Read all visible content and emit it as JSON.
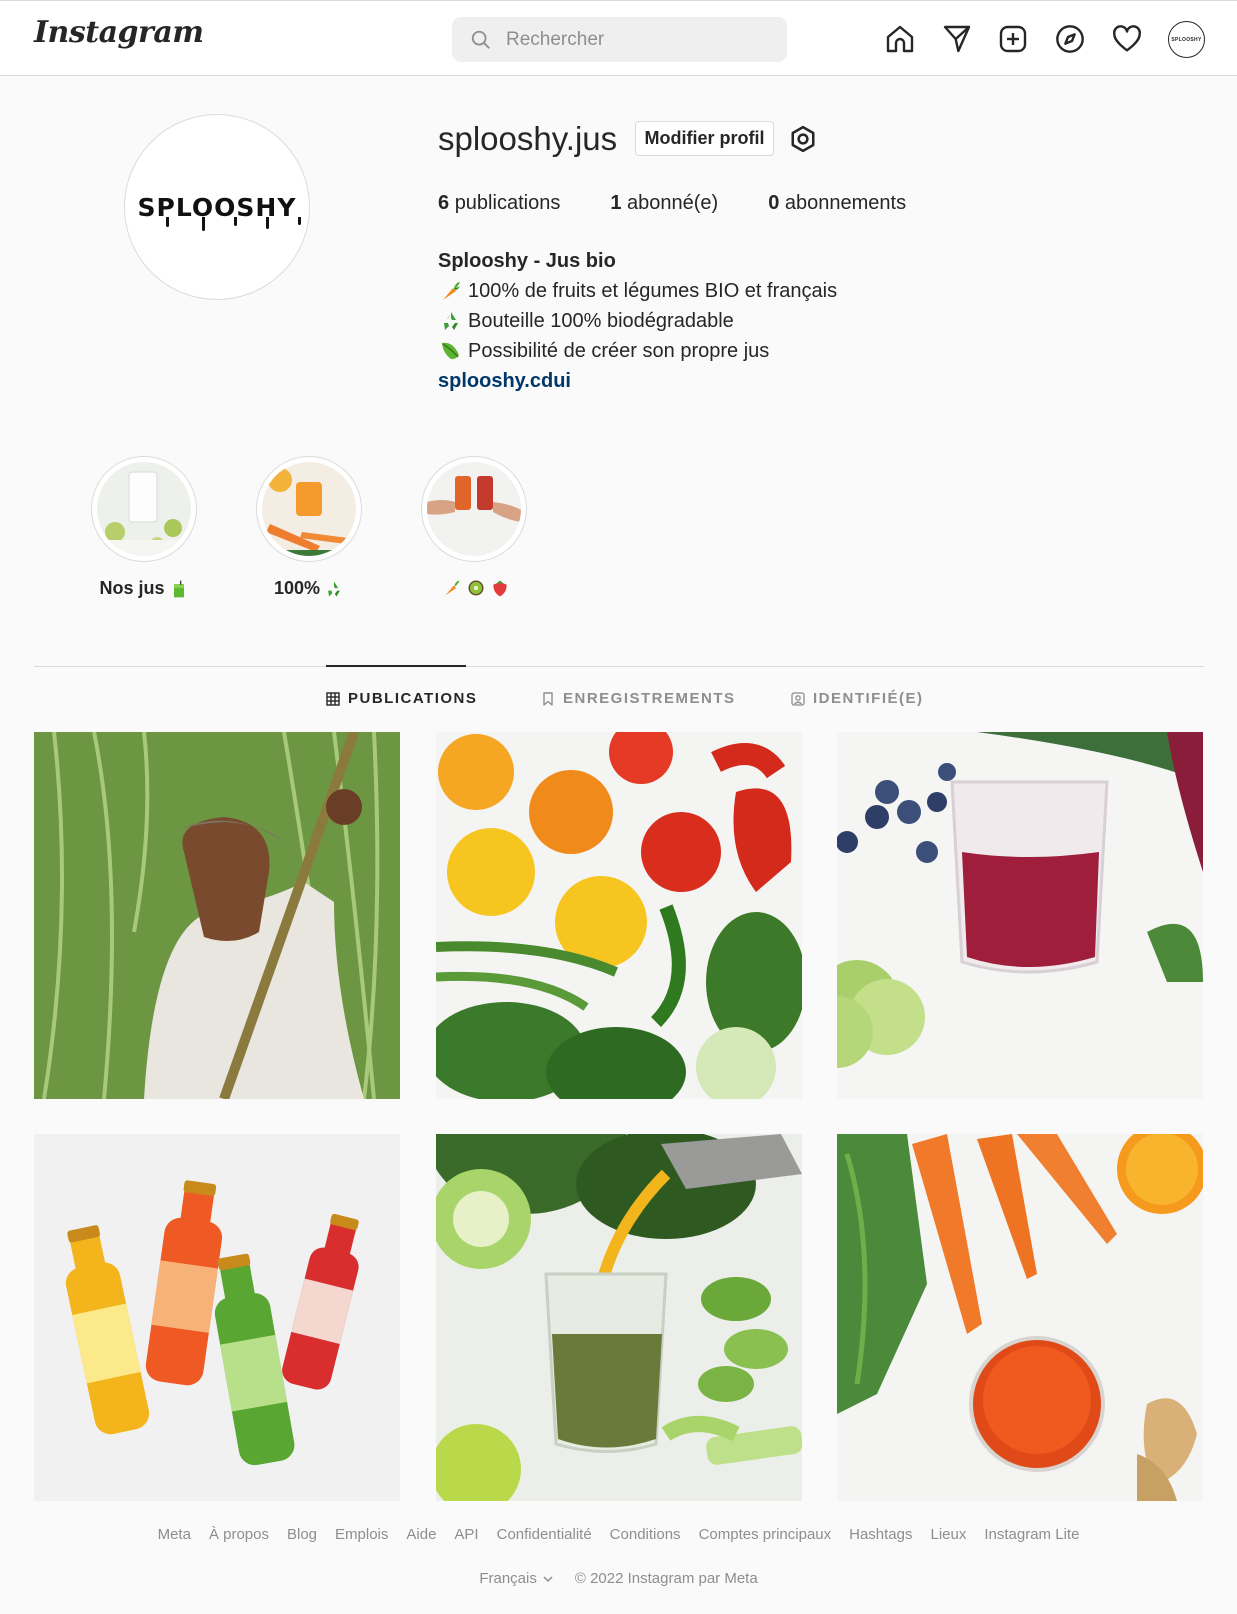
{
  "nav": {
    "logo": "Instagram",
    "search_placeholder": "Rechercher",
    "icons": [
      "home-icon",
      "direct-icon",
      "new-post-icon",
      "explore-icon",
      "activity-icon"
    ],
    "avatar_text": "SPLOOSHY"
  },
  "profile": {
    "avatar_text": "SPLOOSHY",
    "username": "splooshy.jus",
    "edit_button": "Modifier profil",
    "stats": {
      "posts_count": "6",
      "posts_label": "publications",
      "followers_count": "1",
      "followers_label": "abonné(e)",
      "following_count": "0",
      "following_label": "abonnements"
    },
    "bio": {
      "name": "Splooshy - Jus bio",
      "line1": "100% de fruits et légumes BIO et français",
      "line2": "Bouteille 100% biodégradable",
      "line3": "Possibilité de créer son propre jus",
      "link": "splooshy.cdui"
    }
  },
  "highlights": [
    {
      "label": "Nos jus"
    },
    {
      "label": "100%"
    },
    {
      "label": ""
    }
  ],
  "tabs": {
    "publications": "PUBLICATIONS",
    "saved": "ENREGISTREMENTS",
    "tagged": "IDENTIFIÉ(E)"
  },
  "footer": {
    "links": [
      "Meta",
      "À propos",
      "Blog",
      "Emplois",
      "Aide",
      "API",
      "Confidentialité",
      "Conditions",
      "Comptes principaux",
      "Hashtags",
      "Lieux",
      "Instagram Lite"
    ],
    "language": "Français",
    "copyright": "© 2022 Instagram par Meta"
  },
  "colors": {
    "link": "#00376b",
    "border": "#dbdbdb",
    "muted": "#8e8e8e",
    "text": "#262626"
  }
}
